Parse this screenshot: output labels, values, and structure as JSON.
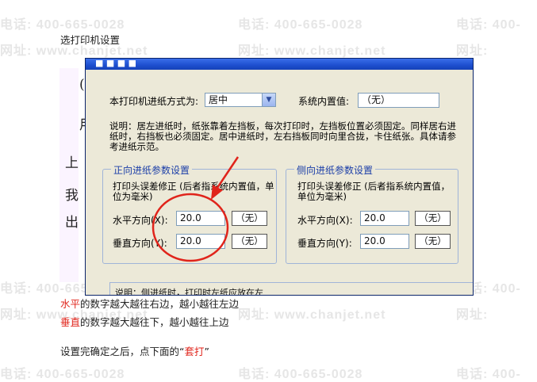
{
  "watermark": {
    "phone": "电话: 400-665-0028",
    "phone_short": "电话: 400-",
    "website": "网址: www.chanjet.net",
    "website_short": "网址:"
  },
  "doc": {
    "heading": "选打印机设置",
    "line_horizontal_key": "水平",
    "line_horizontal_rest": "的数字越大越往右边，越小越往左边",
    "line_vertical_key": "垂直",
    "line_vertical_rest": "的数字越大越往下，越小越往上边",
    "line_final_prefix": "设置完确定之后，点下面的“",
    "line_final_key": "套打",
    "line_final_suffix": "”"
  },
  "background_fragments": [
    "(",
    "用",
    "上",
    "我",
    "出"
  ],
  "dialog": {
    "feed_label": "本打印机进纸方式为:",
    "feed_value": "居中",
    "sys_label": "系统内置值:",
    "sys_value": "（无）",
    "note": "说明：居左进纸时，纸张靠着左挡板，每次打印时，左挡板位置必须固定。同样居右进纸时，右挡板也必须固定。居中进纸时，左右挡板同时向里合拢，卡住纸张。具体请参考进纸示范。",
    "front_group": {
      "title": "正向进纸参数设置",
      "desc": "打印头误差修正 (后者指系统内置值，单位为毫米)",
      "h_label": "水平方向(X):",
      "h_value": "20.0",
      "h_sys": "（无）",
      "v_label": "垂直方向(Y):",
      "v_value": "20.0",
      "v_sys": "（无）"
    },
    "side_group": {
      "title": "侧向进纸参数设置",
      "desc": "打印头误差修正 (后者指系统内置值，单位为毫米)",
      "h_label": "水平方向(X):",
      "h_value": "20.0",
      "h_sys": "（无）",
      "v_label": "垂直方向(Y):",
      "v_value": "20.0",
      "v_sys": "（无）"
    },
    "bottom_note": "说明：侧进纸时，打印时左纸应放在左"
  },
  "colors": {
    "highlight_text": "#e0241b",
    "annotation": "#e0241b",
    "group_title": "#1c3fa8"
  }
}
